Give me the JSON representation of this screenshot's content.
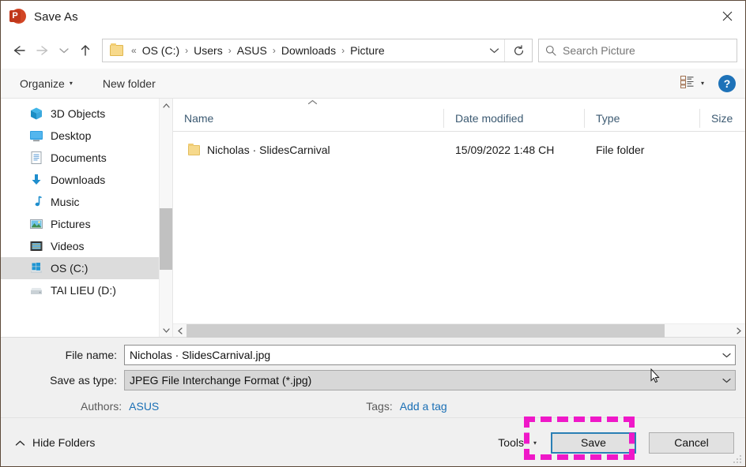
{
  "window": {
    "title": "Save As",
    "app_icon": "powerpoint-icon",
    "app_icon_letter": "P",
    "close_label": "✕"
  },
  "nav": {
    "back": "back-arrow-icon",
    "forward": "forward-arrow-icon",
    "recent": "chevron-down-icon",
    "up": "up-arrow-icon",
    "breadcrumb": {
      "overflow": "«",
      "items": [
        "OS (C:)",
        "Users",
        "ASUS",
        "Downloads",
        "Picture"
      ],
      "separator": "›",
      "dropdown": "chevron-down-icon"
    },
    "refresh": "refresh-icon",
    "search": {
      "placeholder": "Search Picture",
      "value": "",
      "icon": "search-icon"
    }
  },
  "toolbar": {
    "organize": "Organize",
    "organize_caret": "▾",
    "new_folder": "New folder",
    "view_icon": "details-view-icon",
    "view_caret": "▾",
    "help": "?",
    "help_icon": "help-icon"
  },
  "sidebar": {
    "items": [
      {
        "label": "3D Objects",
        "icon": "3d-objects-icon",
        "selected": false
      },
      {
        "label": "Desktop",
        "icon": "desktop-icon",
        "selected": false
      },
      {
        "label": "Documents",
        "icon": "documents-icon",
        "selected": false
      },
      {
        "label": "Downloads",
        "icon": "downloads-icon",
        "selected": false
      },
      {
        "label": "Music",
        "icon": "music-icon",
        "selected": false
      },
      {
        "label": "Pictures",
        "icon": "pictures-icon",
        "selected": false
      },
      {
        "label": "Videos",
        "icon": "videos-icon",
        "selected": false
      },
      {
        "label": "OS (C:)",
        "icon": "windows-drive-icon",
        "selected": true
      },
      {
        "label": "TAI LIEU (D:)",
        "icon": "drive-icon",
        "selected": false
      }
    ],
    "scroll_up": "⌃",
    "scroll_down": "⌄"
  },
  "filelist": {
    "sort_indicator": "⌃",
    "columns": [
      "Name",
      "Date modified",
      "Type",
      "Size"
    ],
    "rows": [
      {
        "name": "Nicholas · SlidesCarnival",
        "date_modified": "15/09/2022 1:48 CH",
        "type": "File folder",
        "size": "",
        "icon": "folder-icon"
      }
    ],
    "hscroll_left": "‹",
    "hscroll_right": "›"
  },
  "form": {
    "file_name_label": "File name:",
    "file_name_value": "Nicholas · SlidesCarnival.jpg",
    "save_as_type_label": "Save as type:",
    "save_as_type_value": "JPEG File Interchange Format (*.jpg)",
    "combo_arrow": "⌄",
    "authors_label": "Authors:",
    "authors_value": "ASUS",
    "tags_label": "Tags:",
    "tags_value": "Add a tag"
  },
  "footer": {
    "hide_folders": "Hide Folders",
    "hide_folders_caret": "⌃",
    "tools": "Tools",
    "tools_caret": "▾",
    "save": "Save",
    "cancel": "Cancel"
  },
  "colors": {
    "annotation": "#ef18c8",
    "focus_border": "#2a7fb5",
    "link": "#1a6fb5",
    "selection": "#dcdcdc",
    "help_blue": "#1e72b8",
    "powerpoint": "#d24625"
  }
}
